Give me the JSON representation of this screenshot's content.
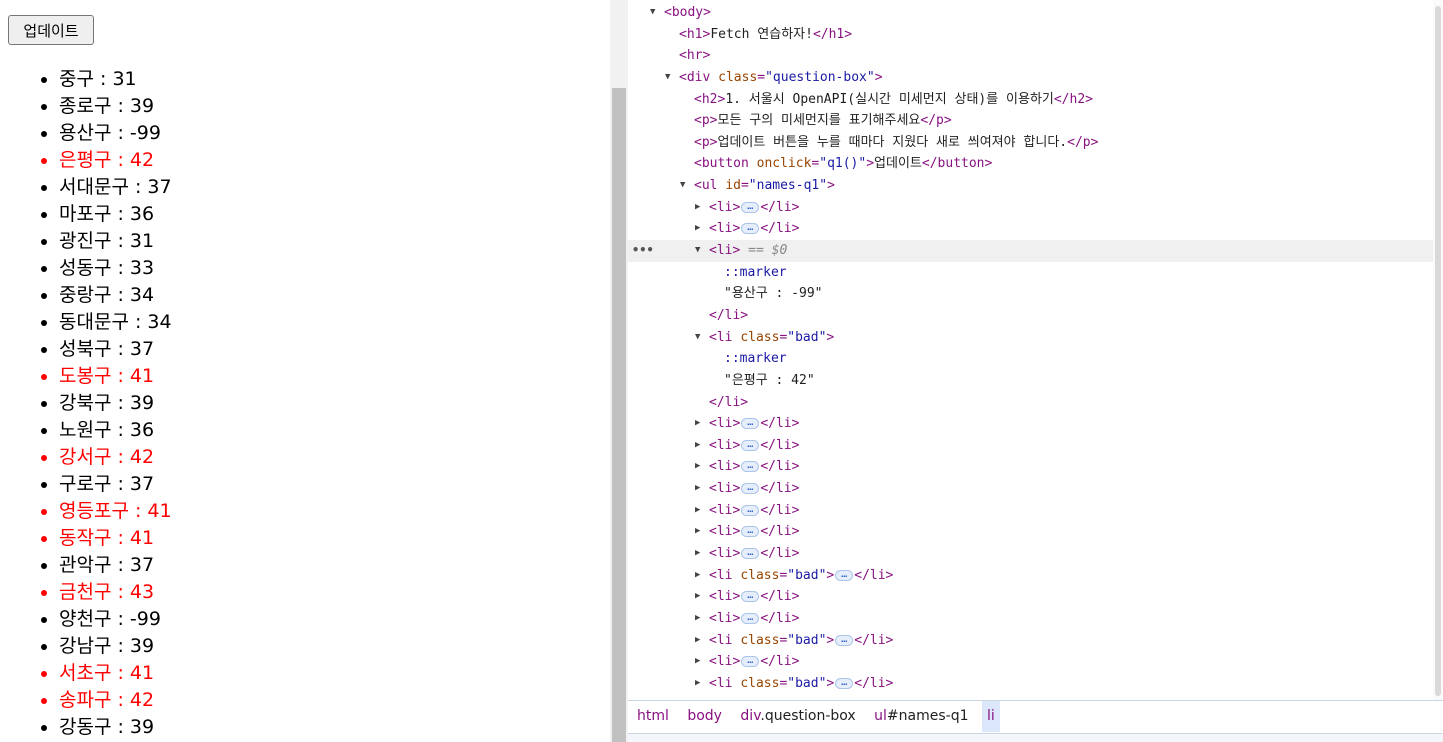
{
  "page": {
    "update_button": "업데이트",
    "districts": [
      {
        "text": "중구 : 31",
        "bad": false
      },
      {
        "text": "종로구 : 39",
        "bad": false
      },
      {
        "text": "용산구 : -99",
        "bad": false
      },
      {
        "text": "은평구 : 42",
        "bad": true
      },
      {
        "text": "서대문구 : 37",
        "bad": false
      },
      {
        "text": "마포구 : 36",
        "bad": false
      },
      {
        "text": "광진구 : 31",
        "bad": false
      },
      {
        "text": "성동구 : 33",
        "bad": false
      },
      {
        "text": "중랑구 : 34",
        "bad": false
      },
      {
        "text": "동대문구 : 34",
        "bad": false
      },
      {
        "text": "성북구 : 37",
        "bad": false
      },
      {
        "text": "도봉구 : 41",
        "bad": true
      },
      {
        "text": "강북구 : 39",
        "bad": false
      },
      {
        "text": "노원구 : 36",
        "bad": false
      },
      {
        "text": "강서구 : 42",
        "bad": true
      },
      {
        "text": "구로구 : 37",
        "bad": false
      },
      {
        "text": "영등포구 : 41",
        "bad": true
      },
      {
        "text": "동작구 : 41",
        "bad": true
      },
      {
        "text": "관악구 : 37",
        "bad": false
      },
      {
        "text": "금천구 : 43",
        "bad": true
      },
      {
        "text": "양천구 : -99",
        "bad": false
      },
      {
        "text": "강남구 : 39",
        "bad": false
      },
      {
        "text": "서초구 : 41",
        "bad": true
      },
      {
        "text": "송파구 : 42",
        "bad": true
      },
      {
        "text": "강동구 : 39",
        "bad": false
      }
    ]
  },
  "devtools": {
    "h1_text": "Fetch 연습하자!",
    "div_class": "\"question-box\"",
    "h2_text": "1. 서울시 OpenAPI(실시간 미세먼지 상태)를 이용하기",
    "p1_text": "모든 구의 미세먼지를 표기해주세요",
    "p2_text": "업데이트 버튼을 누를 때마다 지웠다 새로 씌여져야 합니다.",
    "button_onclick": "\"q1()\"",
    "button_text": "업데이트",
    "ul_id": "\"names-q1\"",
    "selected_marker": "== $0",
    "pseudo_marker": "::marker",
    "li3_text": "\"용산구 : -99\"",
    "li4_class": "\"bad\"",
    "li4_text": "\"은평구 : 42\"",
    "ellipsis": "…",
    "breadcrumbs": {
      "html": "html",
      "body": "body",
      "div_tag": "div",
      "div_cls": ".question-box",
      "ul_tag": "ul",
      "ul_id": "#names-q1",
      "li": "li"
    },
    "collapsed_rows": [
      "li",
      "li",
      "li",
      "li",
      "li",
      "li",
      "li",
      "li.bad",
      "li",
      "li",
      "li.bad",
      "li",
      "li.bad"
    ]
  }
}
